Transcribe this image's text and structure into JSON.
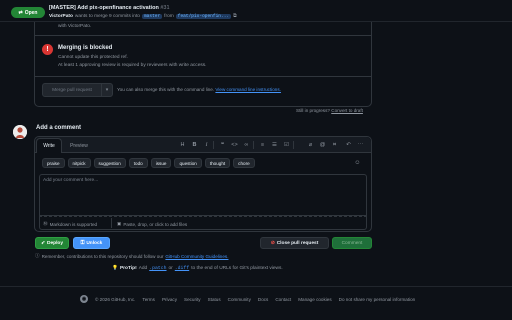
{
  "header": {
    "status": "Open",
    "title": "[MASTER] Add pix-openfinance activation",
    "number": "#31",
    "author": "VictorPato",
    "sub_mid": "wants to merge 9 commits into",
    "base_branch": "master",
    "from_word": "from",
    "head_branch": "feat/pix-openfin..."
  },
  "merge": {
    "with_author": "with VictorPato.",
    "blocked_title": "Merging is blocked",
    "blocked_line1": "Cannot update this protected ref.",
    "blocked_line2": "At least 1 approving review is required by reviewers with write access.",
    "merge_button": "Merge pull request",
    "cli_text": "You can also merge this with the command line.",
    "cli_link": "View command line instructions."
  },
  "draft": {
    "still_text": "Still in progress?",
    "convert_link": "Convert to draft"
  },
  "comment": {
    "heading": "Add a comment",
    "tab_write": "Write",
    "tab_preview": "Preview",
    "chips": [
      "praise",
      "nitpick",
      "suggestion",
      "todo",
      "issue",
      "question",
      "thought",
      "chore"
    ],
    "placeholder": "Add your comment here...",
    "markdown_note": "Markdown is supported",
    "paste_note": "Paste, drop, or click to add files"
  },
  "actions": {
    "deploy": "Deploy",
    "unlock": "Unlock",
    "close_pr": "Close pull request",
    "comment": "Comment"
  },
  "notes": {
    "reminder_text": "Remember, contributions to this repository should follow our",
    "reminder_link": "GitHub Community Guidelines.",
    "protip_label": "ProTip!",
    "protip_add": "Add",
    "protip_patch": ".patch",
    "protip_or": "or",
    "protip_diff": ".diff",
    "protip_rest": "to the end of URLs for Git's plaintext views."
  },
  "footer": {
    "copyright": "© 2026 GitHub, Inc.",
    "links": [
      "Terms",
      "Privacy",
      "Security",
      "Status",
      "Community",
      "Docs",
      "Contact",
      "Manage cookies",
      "Do not share my personal information"
    ]
  },
  "colors": {
    "background": "#0d1117",
    "open_green": "#238636",
    "danger_red": "#da3633",
    "link_blue": "#4493f8"
  },
  "icons": [
    "pull-request-icon",
    "copy-icon",
    "x-circle-icon",
    "chevron-down-icon",
    "heading-icon",
    "bold-icon",
    "italic-icon",
    "quote-icon",
    "code-icon",
    "link-icon",
    "list-icon",
    "numbered-list-icon",
    "task-list-icon",
    "attach-icon",
    "mention-icon",
    "reference-icon",
    "undo-icon",
    "smiley-icon",
    "markdown-icon",
    "image-icon",
    "rocket-icon",
    "lock-icon",
    "close-pr-icon",
    "info-icon",
    "light-bulb-icon",
    "github-mark-icon"
  ]
}
